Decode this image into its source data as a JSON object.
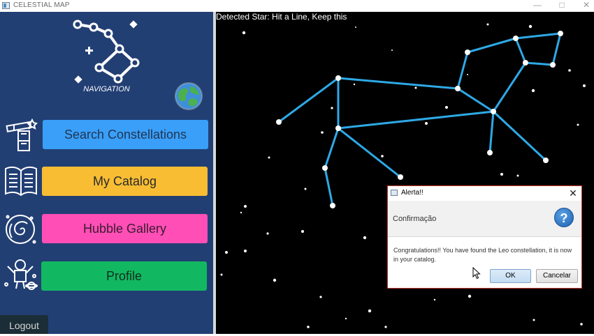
{
  "window": {
    "title": "CELESTIAL MAP",
    "minimize_glyph": "—",
    "maximize_glyph": "□",
    "close_glyph": "✕"
  },
  "sidebar": {
    "nav_label": "NAVIGATION",
    "logo_icon": "constellation-logo-icon",
    "globe_icon": "earth-globe-icon",
    "items": [
      {
        "label": "Search Constellations",
        "color": "#3a9ff8",
        "text_color": "#1f3552",
        "icon": "telescope-icon"
      },
      {
        "label": "My Catalog",
        "color": "#f8bd33",
        "text_color": "#2a2a2a",
        "icon": "book-icon"
      },
      {
        "label": "Hubble Gallery",
        "color": "#ff4fb6",
        "text_color": "#3a1a30",
        "icon": "galaxy-icon"
      },
      {
        "label": "Profile",
        "color": "#12b861",
        "text_color": "#0f2e1e",
        "icon": "astronaut-icon"
      }
    ],
    "logout_label": "Logout"
  },
  "sky": {
    "status_text": "Detected Star: Hit a Line, Keep this",
    "line_color": "#2ea9e6"
  },
  "dialog": {
    "title": "Alerta!!",
    "heading": "Confirmação",
    "message": "Congratulations!! You have found the Leo constellation, it is now in your catalog.",
    "ok_label": "OK",
    "cancel_label": "Cancelar",
    "icon": "question-icon",
    "border_color": "#c0392b"
  }
}
